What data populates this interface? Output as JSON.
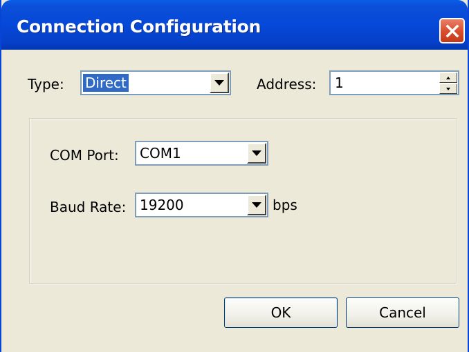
{
  "window": {
    "title": "Connection Configuration",
    "close_icon": "close-x-icon"
  },
  "top_row": {
    "type_label": "Type:",
    "type_value": "Direct",
    "address_label": "Address:",
    "address_value": "1"
  },
  "group": {
    "com_port_label": "COM Port:",
    "com_port_value": "COM1",
    "baud_rate_label": "Baud Rate:",
    "baud_rate_value": "19200",
    "baud_unit": "bps"
  },
  "buttons": {
    "ok_label": "OK",
    "cancel_label": "Cancel"
  },
  "colors": {
    "titlebar": "#0648d8",
    "close_button": "#d9502e",
    "dialog_face": "#ece9d8",
    "selection": "#316ac5"
  }
}
